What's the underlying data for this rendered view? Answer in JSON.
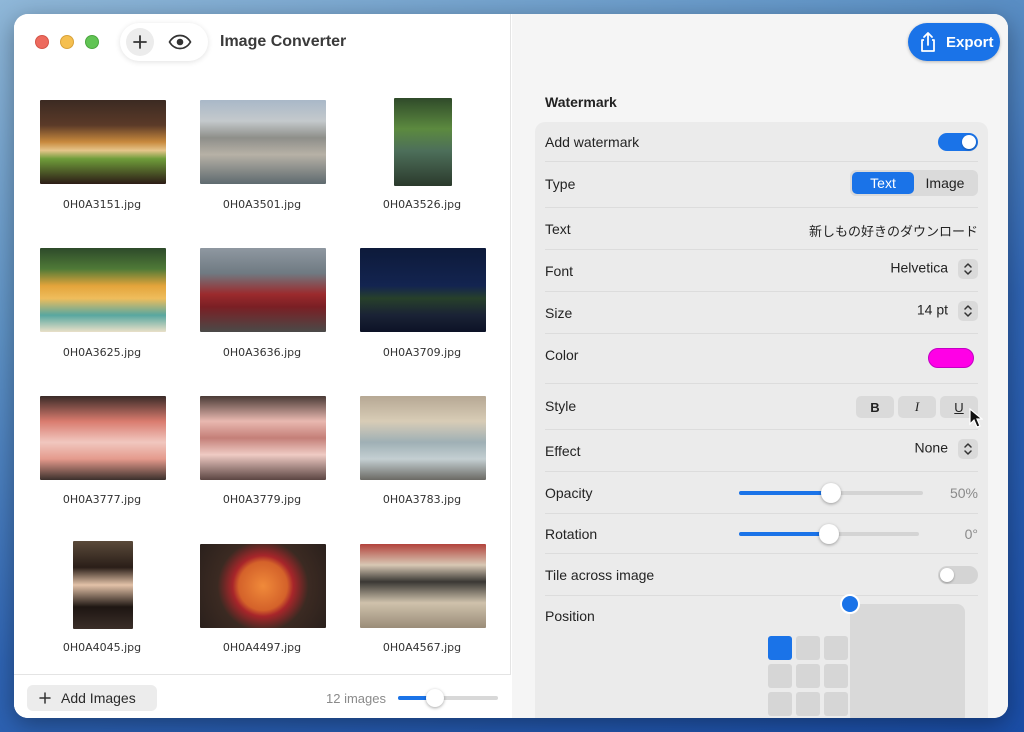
{
  "app": {
    "title": "Image Converter"
  },
  "toolbar": {
    "export_label": "Export"
  },
  "colors": {
    "accent": "#1a73e8",
    "watermark_color": "#ff00e6"
  },
  "gallery": {
    "items": [
      {
        "name": "0H0A3151.jpg"
      },
      {
        "name": "0H0A3501.jpg"
      },
      {
        "name": "0H0A3526.jpg"
      },
      {
        "name": "0H0A3625.jpg"
      },
      {
        "name": "0H0A3636.jpg"
      },
      {
        "name": "0H0A3709.jpg"
      },
      {
        "name": "0H0A3777.jpg"
      },
      {
        "name": "0H0A3779.jpg"
      },
      {
        "name": "0H0A3783.jpg"
      },
      {
        "name": "0H0A4045.jpg"
      },
      {
        "name": "0H0A4497.jpg"
      },
      {
        "name": "0H0A4567.jpg"
      }
    ],
    "add_images_label": "Add Images",
    "count_label": "12 images",
    "thumbnail_size_fraction": 0.37
  },
  "watermark": {
    "section_title": "Watermark",
    "add_watermark": {
      "label": "Add watermark",
      "enabled": true
    },
    "type": {
      "label": "Type",
      "options": [
        "Text",
        "Image"
      ],
      "selected": "Text"
    },
    "text": {
      "label": "Text",
      "value": "新しもの好きのダウンロード"
    },
    "font": {
      "label": "Font",
      "value": "Helvetica"
    },
    "size": {
      "label": "Size",
      "value": "14 pt"
    },
    "color": {
      "label": "Color"
    },
    "style": {
      "label": "Style",
      "bold": "B",
      "italic": "I",
      "underline": "U"
    },
    "effect": {
      "label": "Effect",
      "value": "None"
    },
    "opacity": {
      "label": "Opacity",
      "value_text": "50%",
      "value": 0.5
    },
    "rotation": {
      "label": "Rotation",
      "value_text": "0°",
      "value": 0.5
    },
    "tile": {
      "label": "Tile across image",
      "enabled": false
    },
    "position": {
      "label": "Position",
      "selected": "top-left"
    }
  }
}
